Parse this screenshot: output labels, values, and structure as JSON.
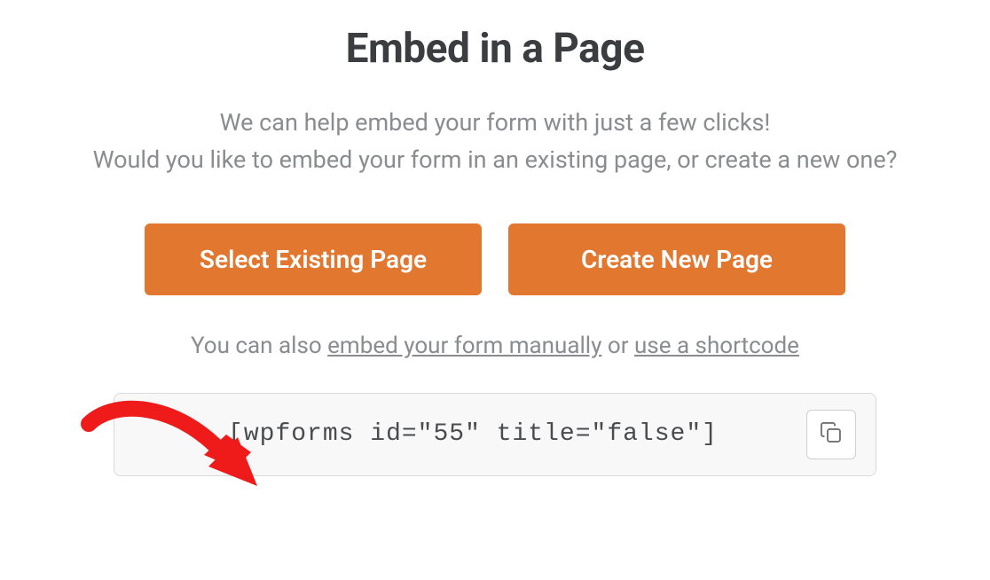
{
  "title": "Embed in a Page",
  "subtitle_line1": "We can help embed your form with just a few clicks!",
  "subtitle_line2": "Would you like to embed your form in an existing page, or create a new one?",
  "buttons": {
    "select_existing": "Select Existing Page",
    "create_new": "Create New Page"
  },
  "helper": {
    "prefix": "You can also ",
    "link_manual": "embed your form manually",
    "middle": " or ",
    "link_shortcode": "use a shortcode"
  },
  "shortcode": "[wpforms id=\"55\" title=\"false\"]",
  "colors": {
    "accent": "#e27730"
  }
}
